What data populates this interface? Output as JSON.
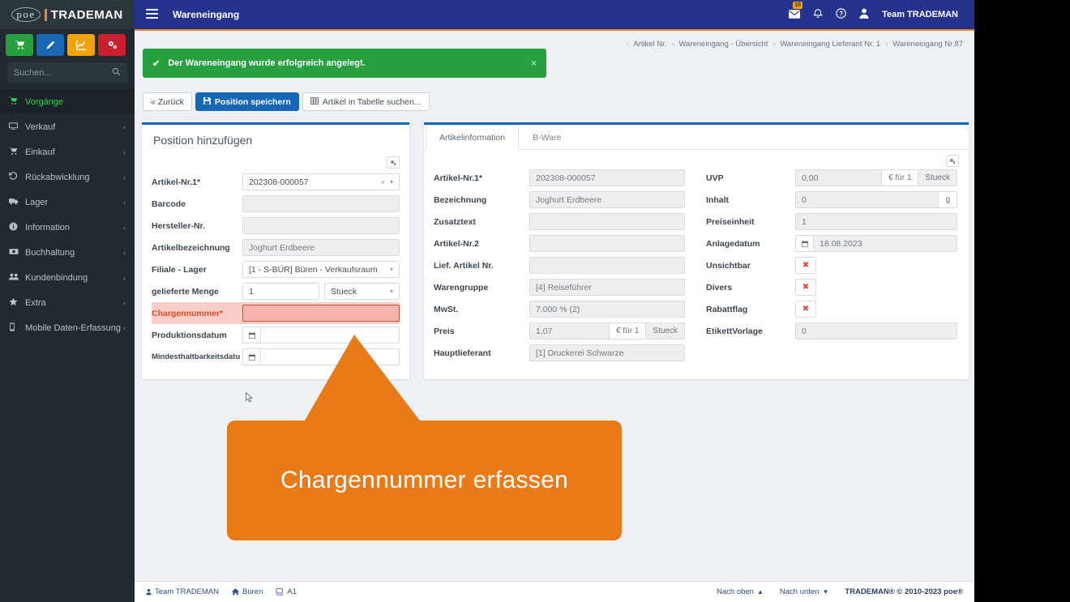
{
  "brand": {
    "logo_circle": "poe",
    "logo_name": "TRADEMAN",
    "accent_orange": "#e8891c",
    "nav_dark": "#212a30",
    "topbar_blue": "#26338c",
    "primary_blue": "#1767b5",
    "success_green": "#27a03f",
    "callout_orange": "#ea7a17",
    "highlight_red": "#f9cdc7"
  },
  "sidebar": {
    "search_placeholder": "Suchen...",
    "search_value": "",
    "search_icon": "search-icon",
    "quick_actions": [
      {
        "name": "cart-button",
        "icon": "cart-icon",
        "color": "#27a03f"
      },
      {
        "name": "edit-button",
        "icon": "pencil-icon",
        "color": "#1767b5"
      },
      {
        "name": "report-button",
        "icon": "chart-icon",
        "color": "#f0a30a"
      },
      {
        "name": "settings-button",
        "icon": "gear-icon",
        "color": "#c8202f"
      }
    ],
    "items": [
      {
        "label": "Vorgänge",
        "icon": "cart-icon",
        "active": true,
        "chevron": ""
      },
      {
        "label": "Verkauf",
        "icon": "monitor-icon",
        "active": false,
        "chevron": "‹"
      },
      {
        "label": "Einkauf",
        "icon": "cart-icon",
        "active": false,
        "chevron": "‹"
      },
      {
        "label": "Rückabwicklung",
        "icon": "undo-icon",
        "active": false,
        "chevron": "‹"
      },
      {
        "label": "Lager",
        "icon": "truck-icon",
        "active": false,
        "chevron": "‹"
      },
      {
        "label": "Information",
        "icon": "info-icon",
        "active": false,
        "chevron": "‹"
      },
      {
        "label": "Buchhaltung",
        "icon": "money-icon",
        "active": false,
        "chevron": "‹"
      },
      {
        "label": "Kundenbindung",
        "icon": "users-icon",
        "active": false,
        "chevron": "‹"
      },
      {
        "label": "Extra",
        "icon": "star-icon",
        "active": false,
        "chevron": "‹"
      },
      {
        "label": "Mobile Daten-Erfassung",
        "icon": "mobile-icon",
        "active": false,
        "chevron": "‹"
      }
    ]
  },
  "topbar": {
    "menu_icon": "hamburger-icon",
    "title": "Wareneingang",
    "mail_icon": "envelope-icon",
    "mail_badge": "15",
    "bell_icon": "bell-icon",
    "help_icon": "question-circle-icon",
    "user_icon": "user-icon",
    "username": "Team TRADEMAN"
  },
  "breadcrumb": {
    "separator": "›",
    "items": [
      "Artikel Nr.",
      "Wareneingang - Übersicht",
      "Wareneingang Lieferant Nr. 1",
      "Wareneingang Nr.87"
    ]
  },
  "alert": {
    "icon": "check-icon",
    "message": "Der Wareneingang wurde erfolgreich angelegt.",
    "close_icon": "close-icon"
  },
  "toolbar": {
    "back_label": "« Zurück",
    "save_label": "Position speichern",
    "save_icon": "save-icon",
    "search_table_label": "Artikel in Tabelle suchen...",
    "search_table_icon": "table-icon"
  },
  "position_panel": {
    "title": "Position hinzufügen",
    "gear_icon": "gear-icon",
    "fields": [
      {
        "label": "Artikel-Nr.1*",
        "value": "202308-000057",
        "type": "select-clear",
        "clear_icon": "clear-icon",
        "caret_icon": "chevron-down-icon"
      },
      {
        "label": "Barcode",
        "value": "",
        "type": "readonly"
      },
      {
        "label": "Hersteller-Nr.",
        "value": "",
        "type": "readonly"
      },
      {
        "label": "Artikelbezeichnung",
        "value": "Joghurt Erdbeere",
        "type": "readonly"
      },
      {
        "label": "Filiale - Lager",
        "value": "[1 - S-BÜR] Büren - Verkaufsraum",
        "type": "select",
        "caret_icon": "chevron-down-icon"
      },
      {
        "label": "gelieferte Menge",
        "value": "1",
        "type": "qty",
        "unit": "Stueck",
        "caret_icon": "chevron-down-icon"
      },
      {
        "label": "Chargennummer*",
        "value": "",
        "type": "required-empty"
      },
      {
        "label": "Produktionsdatum",
        "value": "",
        "type": "date",
        "date_icon": "calendar-icon"
      },
      {
        "label": "Mindesthaltbarkeitsdatu",
        "value": "",
        "type": "date",
        "date_icon": "calendar-icon"
      }
    ]
  },
  "article_panel": {
    "tabs": [
      {
        "label": "Artikelinformation",
        "active": true
      },
      {
        "label": "B-Ware",
        "active": false
      }
    ],
    "gear_icon": "gear-icon",
    "left_fields": [
      {
        "label": "Artikel-Nr.1*",
        "value": "202308-000057",
        "type": "readonly"
      },
      {
        "label": "Bezeichnung",
        "value": "Joghurt Erdbeere",
        "type": "readonly"
      },
      {
        "label": "Zusatztext",
        "value": "",
        "type": "readonly"
      },
      {
        "label": "Artikel-Nr.2",
        "value": "",
        "type": "readonly"
      },
      {
        "label": "Lief. Artikel Nr.",
        "value": "",
        "type": "readonly"
      },
      {
        "label": "Warengruppe",
        "value": "[4] Reiseführer",
        "type": "readonly"
      },
      {
        "label": "MwSt.",
        "value": "7.000 % (2)",
        "type": "readonly"
      },
      {
        "label": "Preis",
        "value": "1,07",
        "type": "price",
        "addon1": "€ für 1",
        "addon2": "Stueck"
      },
      {
        "label": "Hauptlieferant",
        "value": "[1] Druckerei Schwarze",
        "type": "readonly"
      }
    ],
    "right_fields": [
      {
        "label": "UVP",
        "value": "0,00",
        "type": "price",
        "addon1": "€ für 1",
        "addon2": "Stueck"
      },
      {
        "label": "Inhalt",
        "value": "0",
        "type": "unit",
        "addon1": "g"
      },
      {
        "label": "Preiseinheit",
        "value": "1",
        "type": "readonly"
      },
      {
        "label": "Anlagedatum",
        "value": "18.08.2023",
        "type": "date",
        "date_icon": "calendar-icon"
      },
      {
        "label": "Unsichtbar",
        "value": "",
        "type": "flag",
        "flag_icon": "x-icon"
      },
      {
        "label": "Divers",
        "value": "",
        "type": "flag",
        "flag_icon": "x-icon"
      },
      {
        "label": "Rabattflag",
        "value": "",
        "type": "flag",
        "flag_icon": "x-icon"
      },
      {
        "label": "EtikettVorlage",
        "value": "0",
        "type": "readonly"
      }
    ]
  },
  "callout": {
    "text": "Chargennummer erfassen"
  },
  "footer": {
    "user_icon": "user-icon",
    "user": "Team TRADEMAN",
    "branch_icon": "home-icon",
    "branch": "Büren",
    "device_icon": "monitor-icon",
    "device": "A1",
    "top_label": "Nach oben",
    "top_icon": "chevron-up-icon",
    "bottom_label": "Nach unten",
    "bottom_icon": "chevron-down-icon",
    "copyright": "TRADEMAN® © 2010-2023 poe®"
  }
}
